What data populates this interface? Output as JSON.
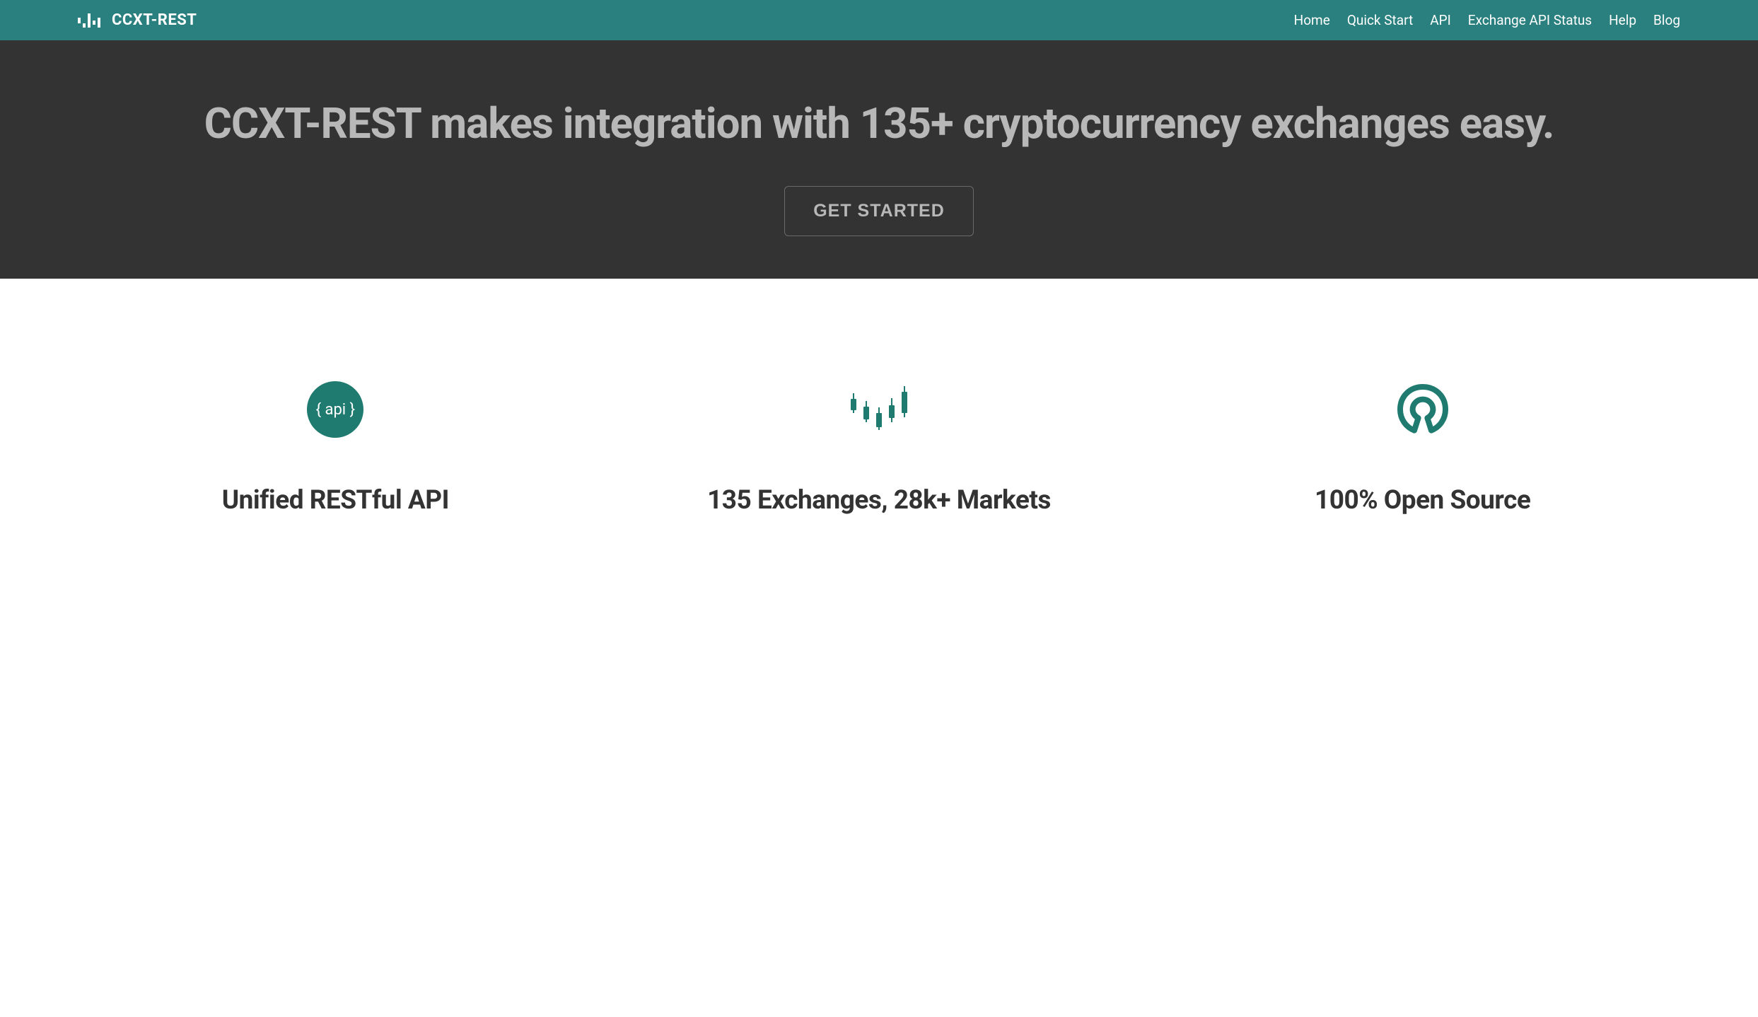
{
  "brand": {
    "name": "CCXT-REST"
  },
  "nav": {
    "items": [
      {
        "label": "Home"
      },
      {
        "label": "Quick Start"
      },
      {
        "label": "API"
      },
      {
        "label": "Exchange API Status"
      },
      {
        "label": "Help"
      },
      {
        "label": "Blog"
      }
    ]
  },
  "hero": {
    "title": "CCXT-REST makes integration with 135+ cryptocurrency exchanges easy.",
    "cta_label": "GET STARTED"
  },
  "features": [
    {
      "icon_text": "{ api }",
      "title": "Unified RESTful API"
    },
    {
      "title": "135 Exchanges, 28k+ Markets"
    },
    {
      "title": "100% Open Source"
    }
  ]
}
